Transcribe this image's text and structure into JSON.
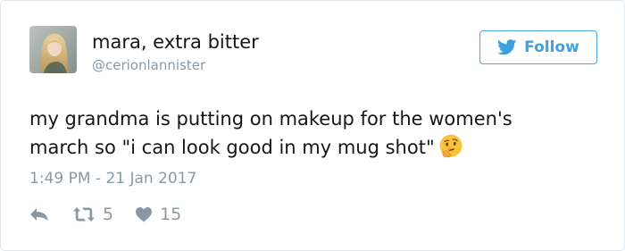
{
  "user": {
    "display_name": "mara, extra bitter",
    "handle": "@cerionlannister"
  },
  "follow_button": {
    "label": "Follow",
    "icon": "twitter-bird-icon",
    "color": "#3ea1de"
  },
  "tweet": {
    "lines": [
      "my grandma is putting on makeup for the women's",
      "march so \"i can look good in my mug shot\""
    ],
    "emoji": "thinking-face-icon"
  },
  "timestamp": "1:49 PM - 21 Jan 2017",
  "actions": {
    "reply_icon": "reply-icon",
    "retweet_icon": "retweet-icon",
    "retweet_count": "5",
    "like_icon": "heart-icon",
    "like_count": "15"
  },
  "colors": {
    "text": "#14171a",
    "muted": "#8899a6",
    "border": "#e1e8ed"
  }
}
